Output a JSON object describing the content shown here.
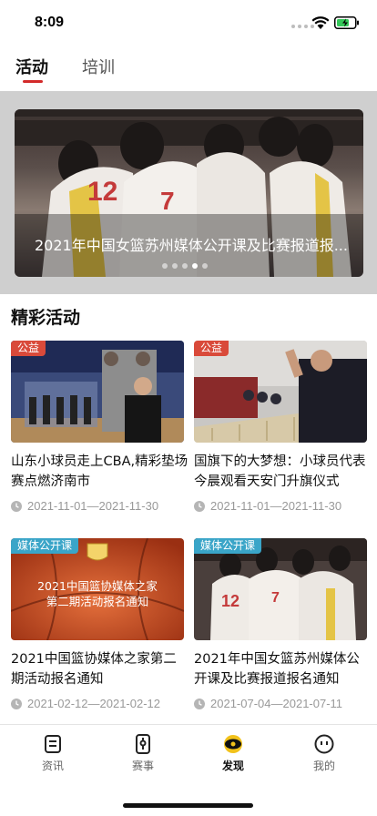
{
  "status_bar": {
    "time": "8:09"
  },
  "top_tabs": [
    {
      "label": "活动",
      "active": true
    },
    {
      "label": "培训",
      "active": false
    }
  ],
  "banner": {
    "caption": "2021年中国女篮苏州媒体公开课及比赛报道报...",
    "dot_count": 5,
    "active_dot_index": 3
  },
  "section": {
    "title": "精彩活动"
  },
  "cards": [
    {
      "tag": "公益",
      "tag_color": "#d94a3a",
      "title": "山东小球员走上CBA,精彩垫场赛点燃济南市",
      "date": "2021-11-01—2021-11-30"
    },
    {
      "tag": "公益",
      "tag_color": "#d94a3a",
      "title": "国旗下的大梦想：小球员代表今晨观看天安门升旗仪式",
      "date": "2021-11-01—2021-11-30"
    },
    {
      "tag": "媒体公开课",
      "tag_color": "#3aa5c8",
      "title": "2021中国篮协媒体之家第二期活动报名通知",
      "date": "2021-02-12—2021-02-12",
      "poster_line1": "2021中国篮协媒体之家",
      "poster_line2": "第二期活动报名通知"
    },
    {
      "tag": "媒体公开课",
      "tag_color": "#3aa5c8",
      "title": "2021年中国女篮苏州媒体公开课及比赛报道报名通知",
      "date": "2021-07-04—2021-07-11"
    }
  ],
  "tab_bar": [
    {
      "label": "资讯",
      "icon": "news-icon",
      "active": false
    },
    {
      "label": "赛事",
      "icon": "match-icon",
      "active": false
    },
    {
      "label": "发现",
      "icon": "discover-icon",
      "active": true
    },
    {
      "label": "我的",
      "icon": "profile-icon",
      "active": false
    }
  ],
  "colors": {
    "accent": "#d32a2a",
    "tag_red": "#d94a3a",
    "tag_blue": "#3aa5c8"
  }
}
